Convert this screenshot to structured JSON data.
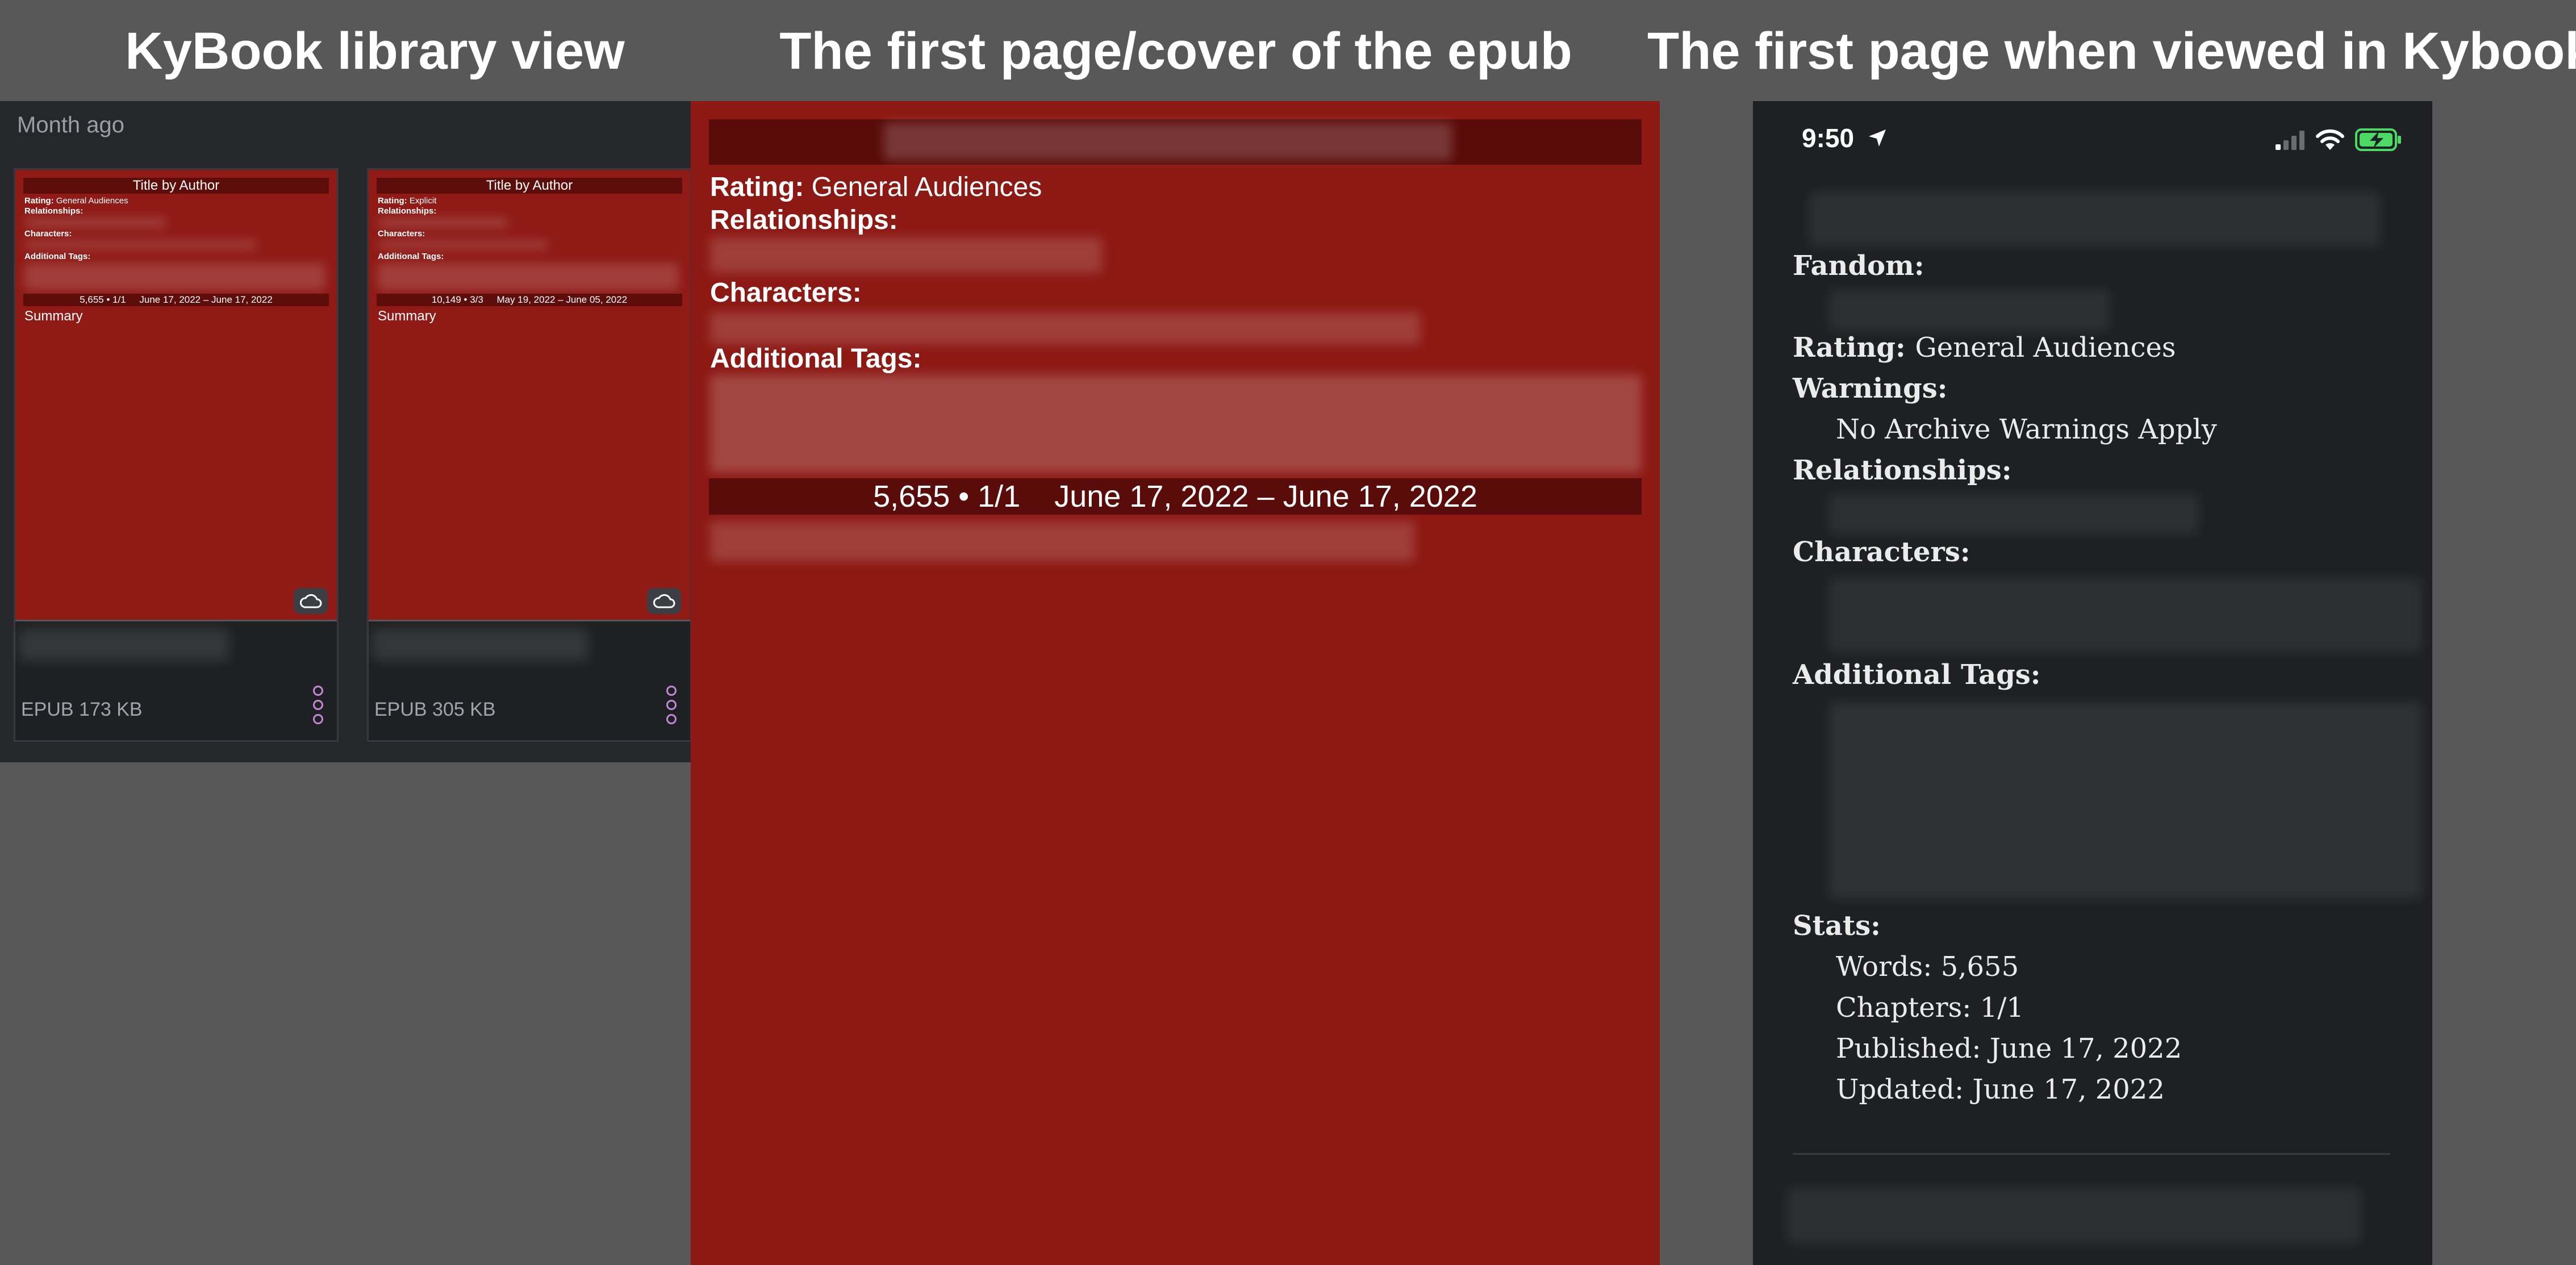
{
  "headings": {
    "library": "KyBook library view",
    "epub": "The first page/cover of the epub",
    "kybook": "The first page when viewed in Kybook"
  },
  "library": {
    "section_label": "Month ago",
    "cards": [
      {
        "cover_title": "Title by Author",
        "rating_label": "Rating:",
        "rating_value": "General Audiences",
        "relationships_label": "Relationships:",
        "characters_label": "Characters:",
        "tags_label": "Additional Tags:",
        "stats": "5,655 • 1/1     June 17, 2022 – June 17, 2022",
        "summary_label": "Summary",
        "file_info": "EPUB 173 KB"
      },
      {
        "cover_title": "Title by Author",
        "rating_label": "Rating:",
        "rating_value": "Explicit",
        "relationships_label": "Relationships:",
        "characters_label": "Characters:",
        "tags_label": "Additional Tags:",
        "stats": "10,149 • 3/3     May 19, 2022 – June 05, 2022",
        "summary_label": "Summary",
        "file_info": "EPUB 305 KB"
      }
    ]
  },
  "epub": {
    "rating_label": "Rating:",
    "rating_value": "General Audiences",
    "relationships_label": "Relationships:",
    "characters_label": "Characters:",
    "tags_label": "Additional Tags:",
    "stats": "5,655 • 1/1    June 17, 2022 – June 17, 2022"
  },
  "kybook": {
    "status_time": "9:50",
    "fandom_label": "Fandom:",
    "rating_label": "Rating:",
    "rating_value": "General Audiences",
    "warnings_label": "Warnings:",
    "warnings_value": "No Archive Warnings Apply",
    "relationships_label": "Relationships:",
    "characters_label": "Characters:",
    "tags_label": "Additional Tags:",
    "stats_label": "Stats:",
    "words": "Words: 5,655",
    "chapters": "Chapters: 1/1",
    "published": "Published: June 17, 2022",
    "updated": "Updated: June 17, 2022"
  },
  "colors": {
    "cover_red": "#8f1a16",
    "bar_dark_red": "#5d0e0b",
    "more_icon": "#c389d6",
    "battery_green": "#4cd964"
  }
}
